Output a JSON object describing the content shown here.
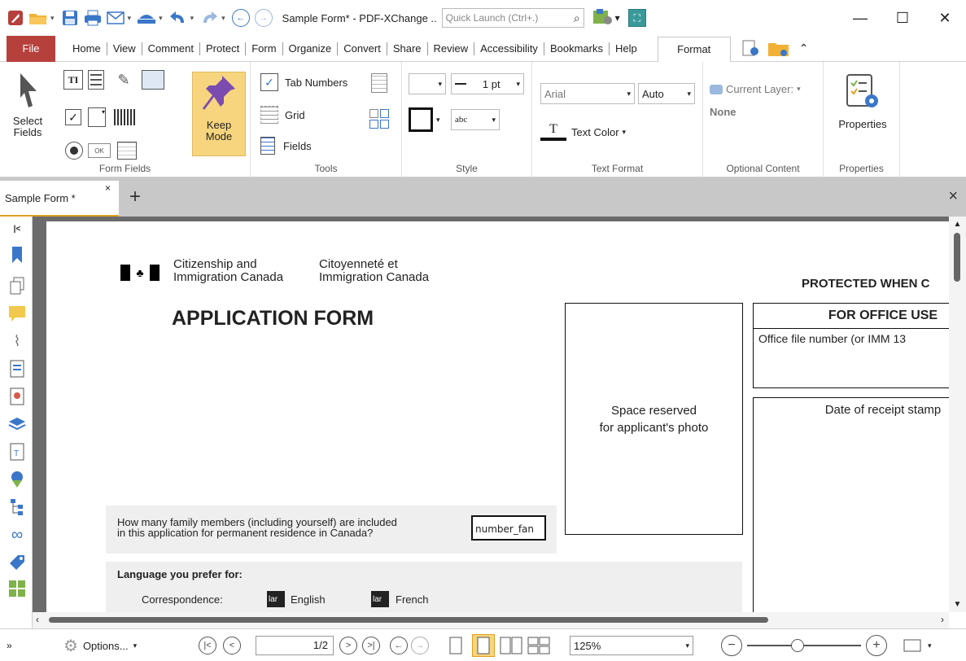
{
  "window": {
    "title": "Sample Form* - PDF-XChange ..",
    "quick_launch_placeholder": "Quick Launch (Ctrl+.)",
    "minimize": "—",
    "maximize": "☐",
    "close": "✕"
  },
  "menu": {
    "file": "File",
    "tabs": [
      "Home",
      "View",
      "Comment",
      "Protect",
      "Form",
      "Organize",
      "Convert",
      "Share",
      "Review",
      "Accessibility",
      "Bookmarks",
      "Help"
    ],
    "active": "Format"
  },
  "ribbon": {
    "form_fields": {
      "select_fields": "Select Fields",
      "keep_mode": "Keep Mode",
      "label": "Form Fields",
      "ok_label": "OK"
    },
    "tools": {
      "tab_numbers": "Tab Numbers",
      "grid": "Grid",
      "fields": "Fields",
      "label": "Tools"
    },
    "style": {
      "line_width": "1 pt",
      "text_style": "abc",
      "label": "Style"
    },
    "text_format": {
      "font": "Arial",
      "size": "Auto",
      "text_color": "Text Color",
      "label": "Text Format"
    },
    "optional_content": {
      "current_layer": "Current Layer:",
      "layer_value": "None",
      "label": "Optional Content"
    },
    "properties": {
      "button": "Properties",
      "label": "Properties"
    }
  },
  "doc_tab": {
    "name": "Sample Form *",
    "close": "×",
    "add": "+",
    "close_all": "×"
  },
  "form": {
    "dept_en_1": "Citizenship and",
    "dept_en_2": "Immigration Canada",
    "dept_fr_1": "Citoyenneté et",
    "dept_fr_2": "Immigration Canada",
    "protected": "PROTECTED WHEN C",
    "title": "APPLICATION FORM",
    "photo_1": "Space reserved",
    "photo_2": "for applicant's photo",
    "office_use": "FOR OFFICE USE",
    "office_file": "Office file number (or IMM 13",
    "receipt": "Date of receipt stamp",
    "family_q_1": "How many family members (including yourself) are included",
    "family_q_2": "in this application for permanent residence in Canada?",
    "family_field": "number_fan",
    "lang_heading": "Language you prefer for:",
    "correspondence": "Correspondence:",
    "lang_field": "lar",
    "english": "English",
    "french": "French"
  },
  "status": {
    "options": "Options...",
    "page_display": "1/2",
    "zoom": "125%"
  },
  "colors": {
    "file_tab": "#b5403c",
    "accent": "#e0a020",
    "keep_mode_bg": "#f6d57e"
  }
}
